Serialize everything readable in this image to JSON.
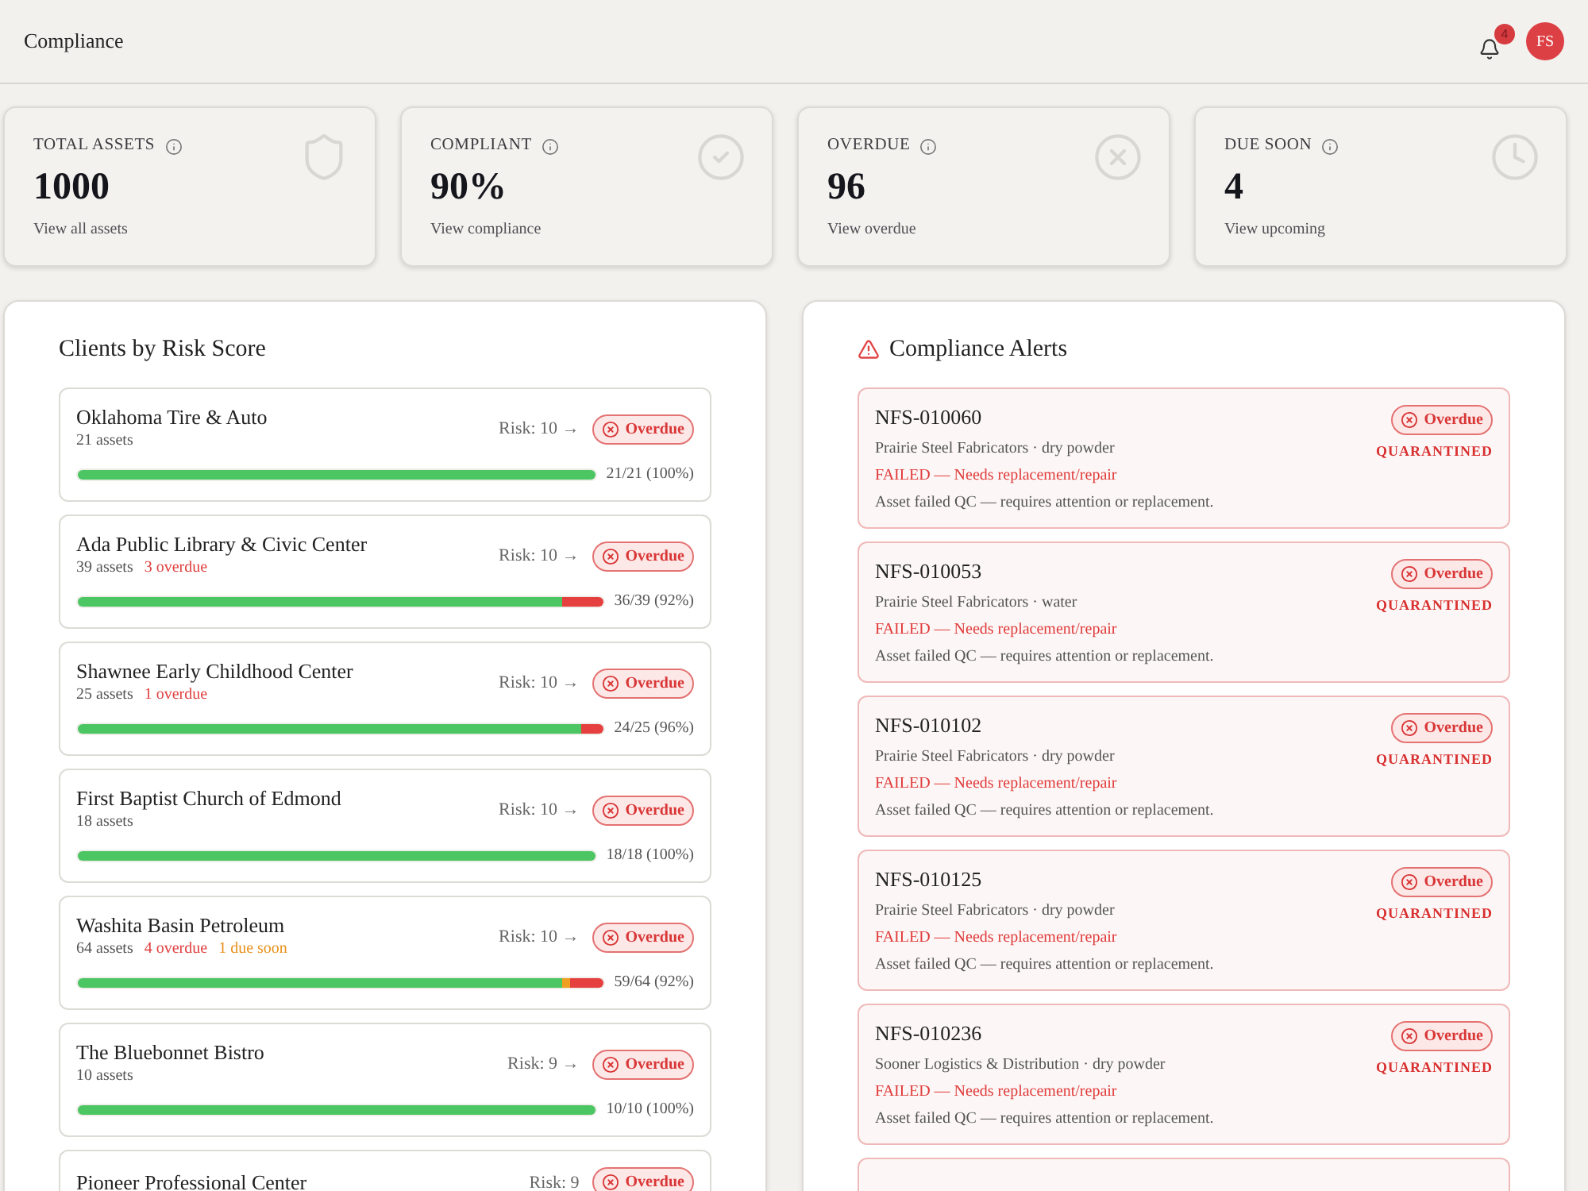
{
  "header": {
    "title": "Compliance",
    "notifications": {
      "count": "4"
    },
    "avatar": {
      "initials": "FS"
    }
  },
  "stats": [
    {
      "kind": "shield",
      "label": "TOTAL ASSETS",
      "value": "1000",
      "link": "View all assets"
    },
    {
      "kind": "check",
      "label": "COMPLIANT",
      "value": "90%",
      "link": "View compliance"
    },
    {
      "kind": "cross",
      "label": "OVERDUE",
      "value": "96",
      "link": "View overdue"
    },
    {
      "kind": "clock",
      "label": "DUE SOON",
      "value": "4",
      "link": "View upcoming"
    }
  ],
  "clients_panel": {
    "title": "Clients by Risk Score",
    "clients": [
      {
        "name": "Oklahoma Tire & Auto",
        "assets": "21 assets",
        "risk": "Risk: 10 →",
        "status": {
          "kind": "overdue",
          "label": "Overdue"
        },
        "progress": [
          {
            "kind": "compliant",
            "level": 1
          }
        ],
        "ratio": "21/21 (100%)"
      },
      {
        "name": "Ada Public Library & Civic Center",
        "assets": "39 assets",
        "overdue": "3 overdue",
        "risk": "Risk: 10 →",
        "status": {
          "kind": "overdue",
          "label": "Overdue"
        },
        "progress": [
          {
            "kind": "compliant",
            "level": 0.923
          },
          {
            "kind": "overdue",
            "level": 0.077
          }
        ],
        "ratio": "36/39 (92%)"
      },
      {
        "name": "Shawnee Early Childhood Center",
        "assets": "25 assets",
        "overdue": "1 overdue",
        "risk": "Risk: 10 →",
        "status": {
          "kind": "overdue",
          "label": "Overdue"
        },
        "progress": [
          {
            "kind": "compliant",
            "level": 0.96
          },
          {
            "kind": "overdue",
            "level": 0.04
          }
        ],
        "ratio": "24/25 (96%)"
      },
      {
        "name": "First Baptist Church of Edmond",
        "assets": "18 assets",
        "risk": "Risk: 10 →",
        "status": {
          "kind": "overdue",
          "label": "Overdue"
        },
        "progress": [
          {
            "kind": "compliant",
            "level": 1
          }
        ],
        "ratio": "18/18 (100%)"
      },
      {
        "name": "Washita Basin Petroleum",
        "assets": "64 assets",
        "overdue": "4 overdue",
        "due_soon": "1 due soon",
        "risk": "Risk: 10 →",
        "status": {
          "kind": "overdue",
          "label": "Overdue"
        },
        "progress": [
          {
            "kind": "compliant",
            "level": 0.922
          },
          {
            "kind": "due_soon",
            "level": 0.016
          },
          {
            "kind": "overdue",
            "level": 0.062
          }
        ],
        "ratio": "59/64 (92%)"
      },
      {
        "name": "The Bluebonnet Bistro",
        "assets": "10 assets",
        "risk": "Risk: 9 →",
        "status": {
          "kind": "overdue",
          "label": "Overdue"
        },
        "progress": [
          {
            "kind": "compliant",
            "level": 1
          }
        ],
        "ratio": "10/10 (100%)"
      },
      {
        "name": "Pioneer Professional Center",
        "risk": "Risk: 9",
        "status": {
          "kind": "overdue",
          "label": "Overdue"
        }
      }
    ]
  },
  "alerts_panel": {
    "title": "Compliance Alerts",
    "alerts": [
      {
        "kind": "full",
        "id": "NFS-010060",
        "detail": "Prairie Steel Fabricators · dry powder",
        "result": "FAILED — Needs replacement/repair",
        "note": "Asset failed QC — requires attention or replacement.",
        "status": {
          "kind": "overdue",
          "label": "Overdue"
        },
        "flag": "QUARANTINED"
      },
      {
        "kind": "full",
        "id": "NFS-010053",
        "detail": "Prairie Steel Fabricators · water",
        "result": "FAILED — Needs replacement/repair",
        "note": "Asset failed QC — requires attention or replacement.",
        "status": {
          "kind": "overdue",
          "label": "Overdue"
        },
        "flag": "QUARANTINED"
      },
      {
        "kind": "full",
        "id": "NFS-010102",
        "detail": "Prairie Steel Fabricators · dry powder",
        "result": "FAILED — Needs replacement/repair",
        "note": "Asset failed QC — requires attention or replacement.",
        "status": {
          "kind": "overdue",
          "label": "Overdue"
        },
        "flag": "QUARANTINED"
      },
      {
        "kind": "full",
        "id": "NFS-010125",
        "detail": "Prairie Steel Fabricators · dry powder",
        "result": "FAILED — Needs replacement/repair",
        "note": "Asset failed QC — requires attention or replacement.",
        "status": {
          "kind": "overdue",
          "label": "Overdue"
        },
        "flag": "QUARANTINED"
      },
      {
        "kind": "full",
        "id": "NFS-010236",
        "detail": "Sooner Logistics & Distribution · dry powder",
        "result": "FAILED — Needs replacement/repair",
        "note": "Asset failed QC — requires attention or replacement.",
        "status": {
          "kind": "overdue",
          "label": "Overdue"
        },
        "flag": "QUARANTINED"
      },
      {
        "kind": "cut_off"
      }
    ]
  }
}
